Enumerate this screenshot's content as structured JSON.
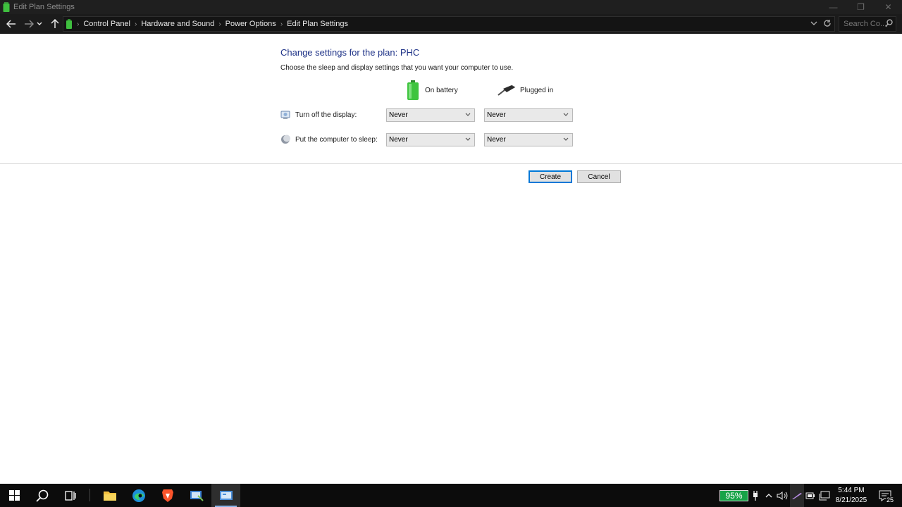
{
  "window": {
    "title": "Edit Plan Settings",
    "controls": {
      "minimize": "—",
      "restore": "❐",
      "close": "✕"
    }
  },
  "address_bar": {
    "breadcrumbs": [
      "Control Panel",
      "Hardware and Sound",
      "Power Options",
      "Edit Plan Settings"
    ],
    "search_placeholder": "Search Co..."
  },
  "page": {
    "heading": "Change settings for the plan: PHC",
    "description": "Choose the sleep and display settings that you want your computer to use.",
    "columns": {
      "battery": "On battery",
      "plugged": "Plugged in"
    },
    "rows": [
      {
        "label": "Turn off the display:",
        "on_battery": "Never",
        "plugged_in": "Never"
      },
      {
        "label": "Put the computer to sleep:",
        "on_battery": "Never",
        "plugged_in": "Never"
      }
    ],
    "buttons": {
      "create": "Create",
      "cancel": "Cancel"
    }
  },
  "taskbar": {
    "battery_percent": "95%",
    "time": "5:44 PM",
    "date": "8/21/2025",
    "notification_count": "25"
  },
  "colors": {
    "heading": "#1e3287",
    "battery_badge": "#17a347",
    "focus_border": "#0078d7"
  }
}
